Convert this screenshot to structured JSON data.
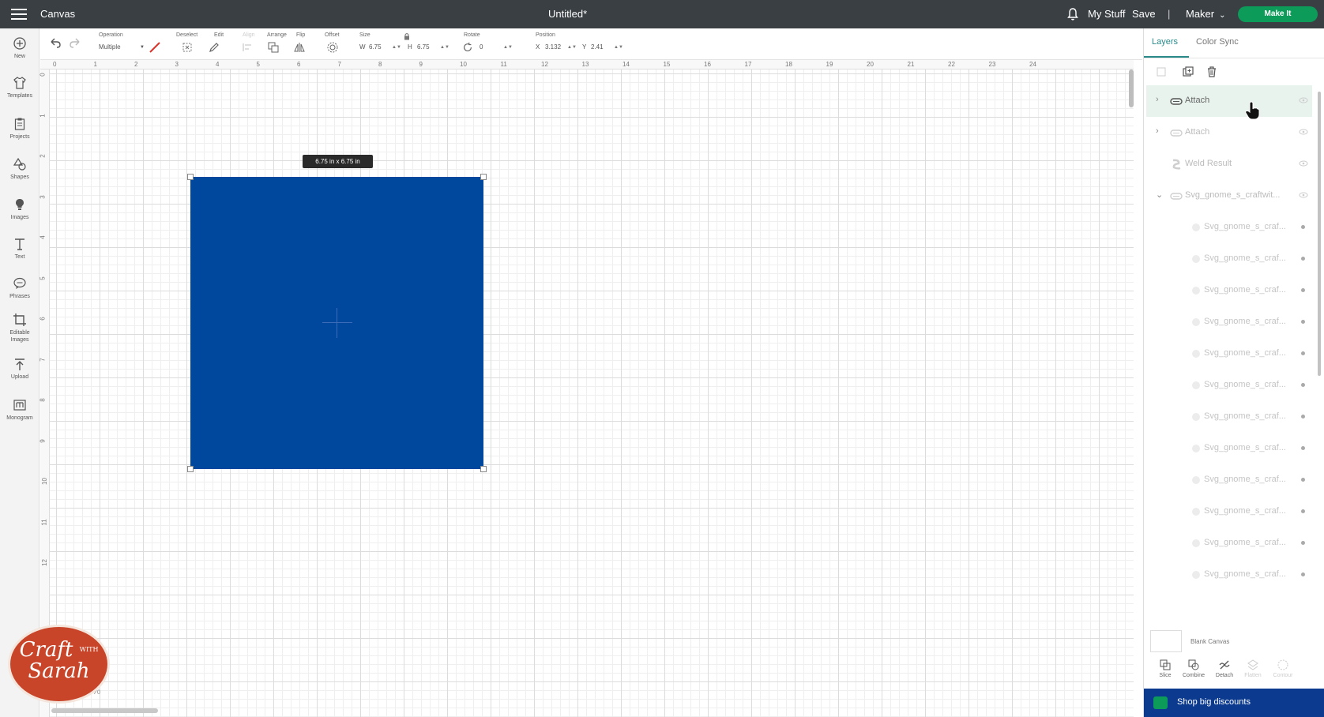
{
  "topbar": {
    "app_name": "Canvas",
    "document_title": "Untitled*",
    "my_stuff": "My Stuff",
    "save": "Save",
    "separator": "|",
    "machine": "Maker",
    "make_it": "Make It"
  },
  "sidebar": {
    "items": [
      {
        "label": "New",
        "icon": "plus-circle-icon"
      },
      {
        "label": "Templates",
        "icon": "shirt-icon"
      },
      {
        "label": "Projects",
        "icon": "clipboard-icon"
      },
      {
        "label": "Shapes",
        "icon": "shapes-icon"
      },
      {
        "label": "Images",
        "icon": "lightbulb-icon"
      },
      {
        "label": "Text",
        "icon": "text-icon"
      },
      {
        "label": "Phrases",
        "icon": "speech-bubble-icon"
      },
      {
        "label": "Editable Images",
        "icon": "crop-icon"
      },
      {
        "label": "Upload",
        "icon": "upload-icon"
      },
      {
        "label": "Monogram",
        "icon": "monogram-icon"
      }
    ]
  },
  "toolbar": {
    "operation_label": "Operation",
    "operation_value": "Multiple",
    "deselect_label": "Deselect",
    "edit_label": "Edit",
    "align_label": "Align",
    "arrange_label": "Arrange",
    "flip_label": "Flip",
    "offset_label": "Offset",
    "size_label": "Size",
    "w_label": "W",
    "w_value": "6.75",
    "h_label": "H",
    "h_value": "6.75",
    "rotate_label": "Rotate",
    "rotate_value": "0",
    "position_label": "Position",
    "x_label": "X",
    "x_value": "3.132",
    "y_label": "Y",
    "y_value": "2.41",
    "accent_color": "#d9342b"
  },
  "rulers": {
    "top": [
      "0",
      "1",
      "2",
      "3",
      "4",
      "5",
      "6",
      "7",
      "8",
      "9",
      "10",
      "11",
      "12",
      "13",
      "14",
      "15",
      "16",
      "17",
      "18",
      "19",
      "20",
      "21",
      "22",
      "23",
      "24"
    ],
    "left": [
      "0",
      "1",
      "2",
      "3",
      "4",
      "5",
      "6",
      "7",
      "8",
      "9",
      "10",
      "11",
      "12"
    ]
  },
  "canvas": {
    "size_tooltip": "6.75  in x 6.75  in",
    "shape_color": "#00479e",
    "zoom_text": "0%"
  },
  "logo": {
    "line1": "Craft",
    "with": "WITH",
    "line2": "Sarah"
  },
  "panel": {
    "tabs": [
      "Layers",
      "Color Sync"
    ],
    "layers": [
      {
        "name": "Attach",
        "kind": "group",
        "icon": "attach-icon",
        "selected": true
      },
      {
        "name": "Attach",
        "kind": "group",
        "icon": "attach-icon",
        "selected": false
      },
      {
        "name": "Weld Result",
        "kind": "item",
        "icon": "weld-icon",
        "selected": false
      },
      {
        "name": "Svg_gnome_s_craftwit...",
        "kind": "group-open",
        "icon": "svg-group-icon",
        "selected": false
      },
      {
        "name": "Svg_gnome_s_craf...",
        "kind": "child"
      },
      {
        "name": "Svg_gnome_s_craf...",
        "kind": "child"
      },
      {
        "name": "Svg_gnome_s_craf...",
        "kind": "child"
      },
      {
        "name": "Svg_gnome_s_craf...",
        "kind": "child"
      },
      {
        "name": "Svg_gnome_s_craf...",
        "kind": "child"
      },
      {
        "name": "Svg_gnome_s_craf...",
        "kind": "child"
      },
      {
        "name": "Svg_gnome_s_craf...",
        "kind": "child"
      },
      {
        "name": "Svg_gnome_s_craf...",
        "kind": "child"
      },
      {
        "name": "Svg_gnome_s_craf...",
        "kind": "child"
      },
      {
        "name": "Svg_gnome_s_craf...",
        "kind": "child"
      },
      {
        "name": "Svg_gnome_s_craf...",
        "kind": "child"
      },
      {
        "name": "Svg_gnome_s_craf...",
        "kind": "child"
      }
    ],
    "blank_canvas": "Blank Canvas",
    "bottom_tools": [
      {
        "label": "Slice",
        "enabled": true
      },
      {
        "label": "Combine",
        "enabled": true
      },
      {
        "label": "Detach",
        "enabled": true
      },
      {
        "label": "Flatten",
        "enabled": false
      },
      {
        "label": "Contour",
        "enabled": false
      }
    ],
    "shop": "Shop big discounts",
    "accent_color": "#2a8a8a",
    "selected_color": "#e9f3ee"
  }
}
